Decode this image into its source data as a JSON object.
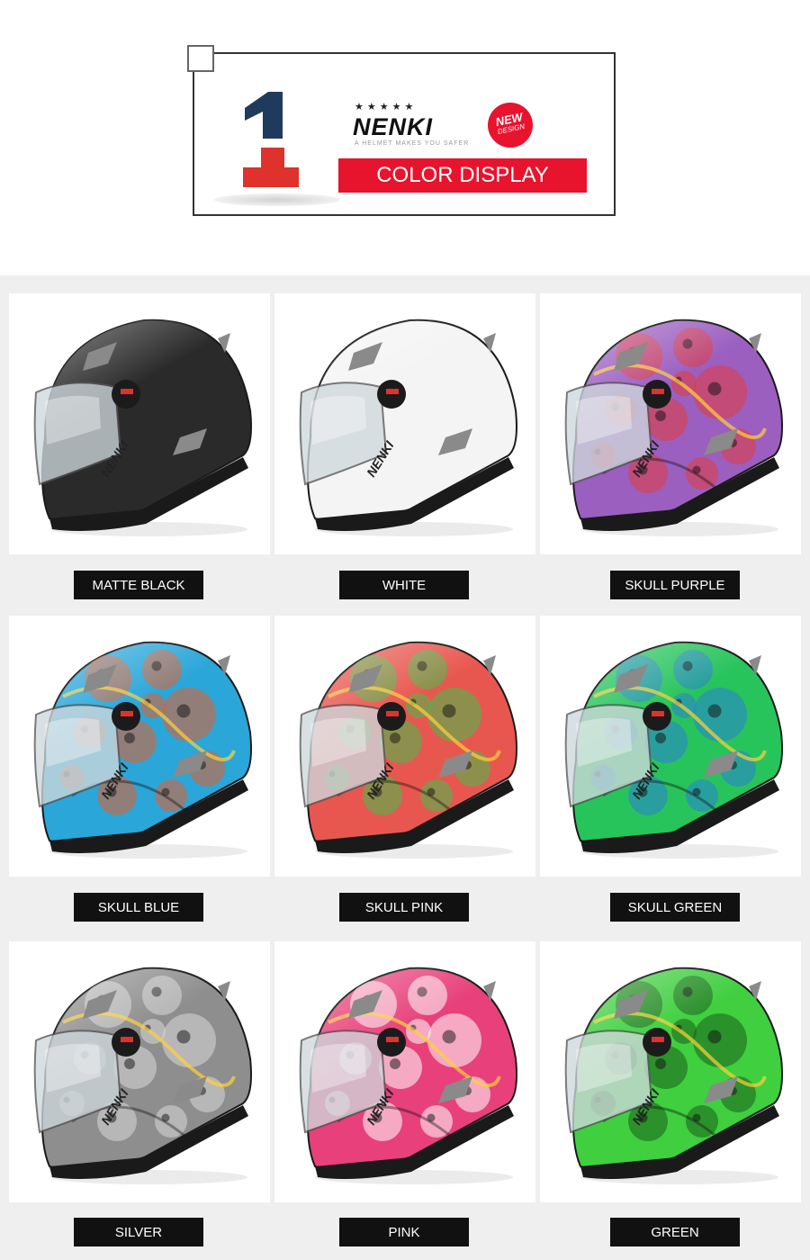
{
  "header": {
    "number": "1",
    "stars": "★★★★★",
    "brand": "NENKI",
    "tagline": "A HELMET MAKES YOU SAFER",
    "badge_line1": "NEW",
    "badge_line2": "DESIGN",
    "banner": "COLOR DISPLAY"
  },
  "colors": {
    "accent_red": "#e8132d",
    "number_navy": "#1f3a5c",
    "label_bg": "#111111",
    "panel_bg": "#efefef"
  },
  "helmets": [
    {
      "label": "MATTE BLACK",
      "base": "#2a2a2a",
      "pattern": "solid",
      "accent": "#3a3a3a"
    },
    {
      "label": "WHITE",
      "base": "#f4f4f4",
      "pattern": "solid",
      "accent": "#dcdcdc"
    },
    {
      "label": "SKULL PURPLE",
      "base": "#9b5fc0",
      "pattern": "skull",
      "accent": "#e23a3a"
    },
    {
      "label": "SKULL BLUE",
      "base": "#2aa6d9",
      "pattern": "skull",
      "accent": "#e85c2a"
    },
    {
      "label": "SKULL PINK",
      "base": "#e8574f",
      "pattern": "skull",
      "accent": "#3fbf4a"
    },
    {
      "label": "SKULL GREEN",
      "base": "#27c45c",
      "pattern": "skull",
      "accent": "#2b7fd6"
    },
    {
      "label": "SILVER",
      "base": "#8e8e8e",
      "pattern": "skull",
      "accent": "#d9d9d9"
    },
    {
      "label": "PINK",
      "base": "#e8407a",
      "pattern": "skull",
      "accent": "#ffffff"
    },
    {
      "label": "GREEN",
      "base": "#3fcf3f",
      "pattern": "skull",
      "accent": "#1b5e1b"
    }
  ]
}
